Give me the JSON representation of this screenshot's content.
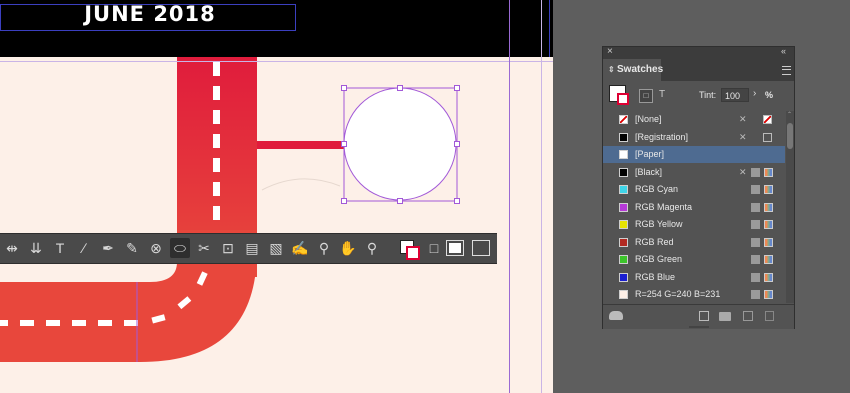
{
  "document": {
    "title": "JUNE 2018"
  },
  "toolbar": {
    "tools": [
      {
        "name": "gap-tool-icon",
        "glyph": "⇹"
      },
      {
        "name": "content-collector-icon",
        "glyph": "⇊"
      },
      {
        "name": "type-tool-icon",
        "glyph": "T"
      },
      {
        "name": "line-tool-icon",
        "glyph": "∕"
      },
      {
        "name": "pen-tool-icon",
        "glyph": "✒"
      },
      {
        "name": "pencil-tool-icon",
        "glyph": "✎"
      },
      {
        "name": "erase-tool-icon",
        "glyph": "⊗"
      },
      {
        "name": "ellipse-tool-icon",
        "glyph": "⬭"
      },
      {
        "name": "scissors-tool-icon",
        "glyph": "✂"
      },
      {
        "name": "free-transform-tool-icon",
        "glyph": "⊡"
      },
      {
        "name": "gradient-tool-icon",
        "glyph": "▤"
      },
      {
        "name": "gradient-feather-tool-icon",
        "glyph": "▧"
      },
      {
        "name": "note-tool-icon",
        "glyph": "✍"
      },
      {
        "name": "eyedropper-tool-icon",
        "glyph": "⚲"
      },
      {
        "name": "hand-tool-icon",
        "glyph": "✋"
      },
      {
        "name": "zoom-tool-icon",
        "glyph": "⚲"
      }
    ]
  },
  "swatches_panel": {
    "tab_label": "Swatches",
    "tint_label": "Tint:",
    "tint_value": "100",
    "tint_unit": "%",
    "swatches": [
      {
        "name": "[None]",
        "color": "none",
        "selected": false
      },
      {
        "name": "[Registration]",
        "color": "#000000",
        "selected": false
      },
      {
        "name": "[Paper]",
        "color": "#ffffff",
        "selected": true
      },
      {
        "name": "[Black]",
        "color": "#000000",
        "selected": false
      },
      {
        "name": "RGB Cyan",
        "color": "#3fd4e8",
        "selected": false
      },
      {
        "name": "RGB Magenta",
        "color": "#b63ad8",
        "selected": false
      },
      {
        "name": "RGB Yellow",
        "color": "#e6e300",
        "selected": false
      },
      {
        "name": "RGB Red",
        "color": "#b22a22",
        "selected": false
      },
      {
        "name": "RGB Green",
        "color": "#3cc42a",
        "selected": false
      },
      {
        "name": "RGB Blue",
        "color": "#1a1ed0",
        "selected": false
      },
      {
        "name": "R=254 G=240 B=231",
        "color": "#fef0e7",
        "selected": false
      }
    ]
  },
  "colors": {
    "road": "#e02a3c",
    "selection": "#a259d8",
    "panel_selected_row": "#4e6b91"
  }
}
